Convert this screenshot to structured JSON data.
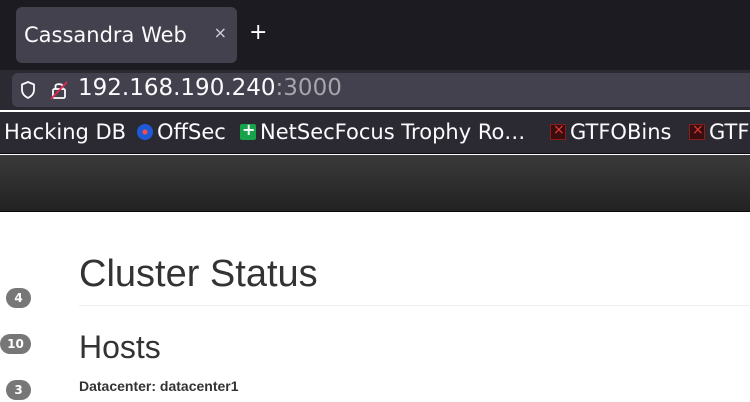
{
  "browser": {
    "tab": {
      "title": "Cassandra Web",
      "close_glyph": "×"
    },
    "new_tab_glyph": "+",
    "url": {
      "host": "192.168.190.240",
      "port": ":3000"
    },
    "bookmarks": [
      {
        "label": "Hacking DB",
        "icon": ""
      },
      {
        "label": "OffSec",
        "icon": "offsec-icon"
      },
      {
        "label": "NetSecFocus Trophy Ro…",
        "icon": "netsecfocus-icon"
      },
      {
        "label": "GTFOBins",
        "icon": "gtfobins-icon"
      },
      {
        "label": "GTF",
        "icon": "gtfobins-icon"
      }
    ]
  },
  "sidebar_badges": [
    "4",
    "10",
    "3"
  ],
  "page": {
    "title": "Cluster Status",
    "section": "Hosts",
    "datacenter_label": "Datacenter: datacenter1"
  },
  "colors": {
    "tabbar": "#1c1b22",
    "toolbar": "#2b2a33",
    "urlbar": "#42414d",
    "badge": "#777777",
    "heading": "#333333"
  }
}
